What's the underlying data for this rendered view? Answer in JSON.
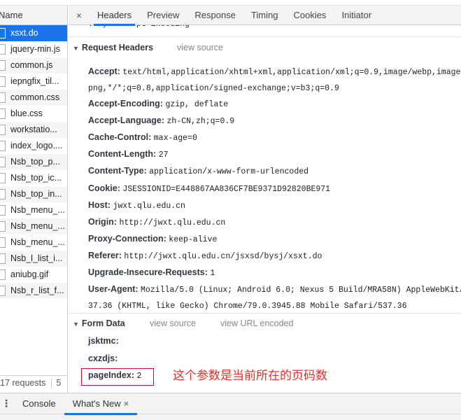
{
  "network": {
    "name_header": "Name",
    "files": [
      {
        "name": "xsxt.do",
        "selected": true
      },
      {
        "name": "jquery-min.js"
      },
      {
        "name": "common.js"
      },
      {
        "name": "iepngfix_til..."
      },
      {
        "name": "common.css"
      },
      {
        "name": "blue.css"
      },
      {
        "name": "workstatio..."
      },
      {
        "name": "index_logo...."
      },
      {
        "name": "Nsb_top_p..."
      },
      {
        "name": "Nsb_top_ic..."
      },
      {
        "name": "Nsb_top_in..."
      },
      {
        "name": "Nsb_menu_..."
      },
      {
        "name": "Nsb_menu_..."
      },
      {
        "name": "Nsb_menu_..."
      },
      {
        "name": "Nsb_l_list_i..."
      },
      {
        "name": "aniubg.gif"
      },
      {
        "name": "Nsb_r_list_f..."
      }
    ],
    "footer_requests": "17 requests",
    "footer_extra": "5"
  },
  "detail": {
    "close": "×",
    "tabs": [
      "Headers",
      "Preview",
      "Response",
      "Timing",
      "Cookies",
      "Initiator"
    ],
    "active_tab": "Headers",
    "vary_line": "Vary: Accept-Encoding",
    "request_headers_title": "Request Headers",
    "view_source": "view source",
    "headers": [
      {
        "k": "Accept:",
        "v": "text/html,application/xhtml+xml,application/xml;q=0.9,image/webp,image/ap"
      },
      {
        "k": "",
        "v": "png,*/*;q=0.8,application/signed-exchange;v=b3;q=0.9"
      },
      {
        "k": "Accept-Encoding:",
        "v": "gzip, deflate"
      },
      {
        "k": "Accept-Language:",
        "v": "zh-CN,zh;q=0.9"
      },
      {
        "k": "Cache-Control:",
        "v": "max-age=0"
      },
      {
        "k": "Content-Length:",
        "v": "27"
      },
      {
        "k": "Content-Type:",
        "v": "application/x-www-form-urlencoded"
      },
      {
        "k": "Cookie:",
        "v": "JSESSIONID=E448867AA836CF7BE9371D92820BE971"
      },
      {
        "k": "Host:",
        "v": "jwxt.qlu.edu.cn"
      },
      {
        "k": "Origin:",
        "v": "http://jwxt.qlu.edu.cn"
      },
      {
        "k": "Proxy-Connection:",
        "v": "keep-alive"
      },
      {
        "k": "Referer:",
        "v": "http://jwxt.qlu.edu.cn/jsxsd/bysj/xsxt.do"
      },
      {
        "k": "Upgrade-Insecure-Requests:",
        "v": "1"
      },
      {
        "k": "User-Agent:",
        "v": "Mozilla/5.0 (Linux; Android 6.0; Nexus 5 Build/MRA58N) AppleWebKit/5"
      },
      {
        "k": "",
        "v": "37.36 (KHTML, like Gecko) Chrome/79.0.3945.88 Mobile Safari/537.36"
      }
    ],
    "form_data_title": "Form Data",
    "view_url_encoded": "view URL encoded",
    "form": [
      {
        "k": "jsktmc:",
        "v": ""
      },
      {
        "k": "cxzdjs:",
        "v": ""
      },
      {
        "k": "pageIndex:",
        "v": "2"
      }
    ],
    "annotation": "这个参数是当前所在的页码数"
  },
  "drawer": {
    "menu": "⋮",
    "tabs": [
      "Console",
      "What's New"
    ],
    "active_tab": "What's New",
    "close": "×"
  },
  "colors": {
    "accent": "#1a73e8",
    "annotation": "#e0302c"
  }
}
